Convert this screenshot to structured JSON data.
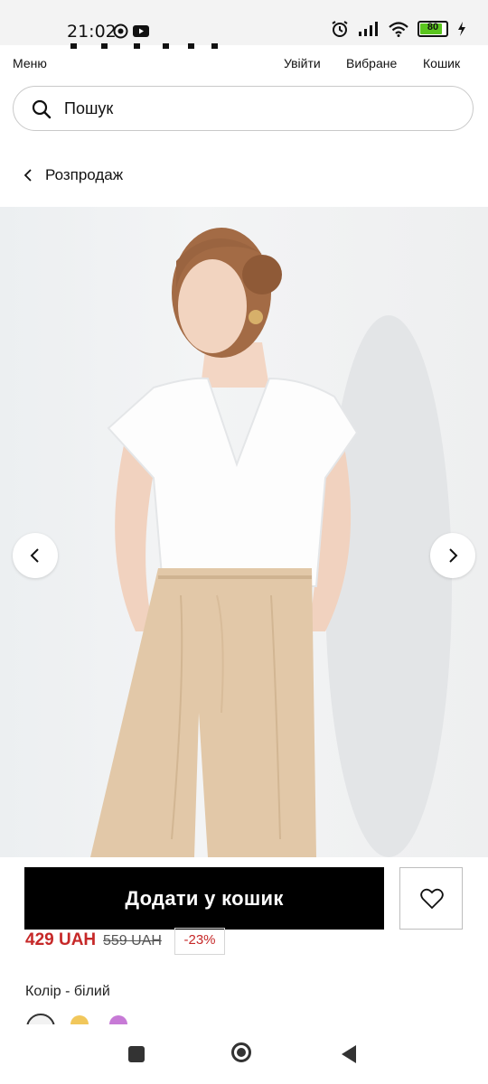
{
  "status_bar": {
    "time": "21:02",
    "battery_level": "80",
    "icons": [
      "record-icon",
      "youtube-icon",
      "alarm-icon",
      "signal-icon",
      "wifi-icon",
      "battery-icon",
      "charging-icon"
    ]
  },
  "top_nav": {
    "menu": "Меню",
    "login": "Увійти",
    "favorites": "Вибране",
    "cart": "Кошик"
  },
  "search": {
    "placeholder": "Пошук"
  },
  "breadcrumb": {
    "label": "Розпродаж"
  },
  "product": {
    "add_to_cart": "Додати у кошик",
    "price": "429 UAH",
    "old_price": "559 UAH",
    "discount": "-23%",
    "color_label": "Колір - білий",
    "swatch_colors": [
      "#f2f2f2",
      "#f1c75b",
      "#c77ad6"
    ]
  },
  "colors": {
    "accent_black": "#000000",
    "sale_red": "#c62828"
  }
}
